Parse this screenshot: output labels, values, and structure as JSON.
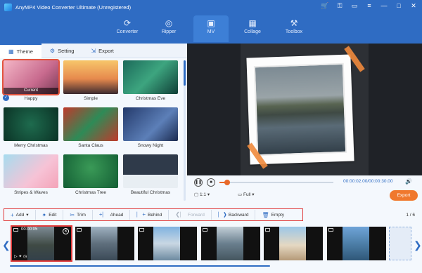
{
  "app": {
    "title": "AnyMP4 Video Converter Ultimate (Unregistered)"
  },
  "window_controls": [
    "cart-icon",
    "key-icon",
    "chat-icon",
    "menu-icon",
    "minimize-icon",
    "maximize-icon",
    "close-icon"
  ],
  "nav": {
    "items": [
      {
        "label": "Converter",
        "icon": "converter-icon"
      },
      {
        "label": "Ripper",
        "icon": "ripper-icon"
      },
      {
        "label": "MV",
        "icon": "mv-icon",
        "active": true
      },
      {
        "label": "Collage",
        "icon": "collage-icon"
      },
      {
        "label": "Toolbox",
        "icon": "toolbox-icon"
      }
    ]
  },
  "tabs": [
    {
      "label": "Theme",
      "active": true
    },
    {
      "label": "Setting"
    },
    {
      "label": "Export"
    }
  ],
  "themes": [
    {
      "label": "Happy",
      "badge": "Current",
      "selected": true
    },
    {
      "label": "Simple"
    },
    {
      "label": "Christmas Eve"
    },
    {
      "label": "Merry Christmas"
    },
    {
      "label": "Santa Claus"
    },
    {
      "label": "Snowy Night"
    },
    {
      "label": "Stripes & Waves"
    },
    {
      "label": "Christmas Tree"
    },
    {
      "label": "Beautiful Christmas"
    }
  ],
  "player": {
    "timecode": "00:00:02.00/00:00:30.00",
    "progress": 0.07,
    "aspect": "1:1",
    "display": "Full",
    "export_label": "Export"
  },
  "toolbar": {
    "add": "Add",
    "edit": "Edit",
    "trim": "Trim",
    "ahead": "Ahead",
    "behind": "Behind",
    "forward": "Forward",
    "backward": "Backward",
    "empty": "Empty",
    "page": "1 / 6"
  },
  "timeline": {
    "clips": [
      {
        "time": "00:00:05",
        "selected": true
      },
      {},
      {},
      {},
      {},
      {}
    ]
  },
  "colors": {
    "brand": "#2f6cc3",
    "accent": "#f0782d",
    "highlight": "#e03a3a"
  }
}
